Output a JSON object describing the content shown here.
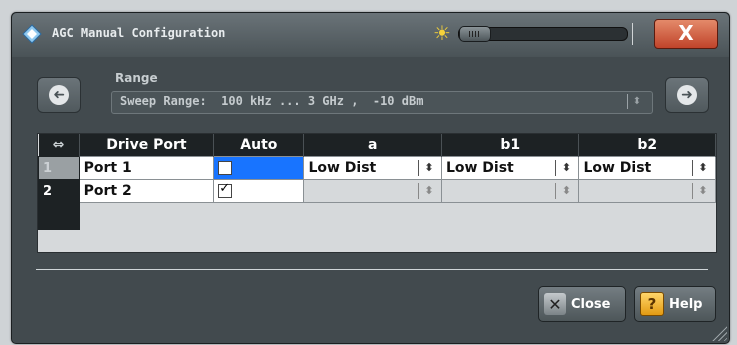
{
  "window": {
    "title": "AGC Manual Configuration",
    "close_symbol": "X"
  },
  "range": {
    "label": "Range",
    "value": "Sweep Range:  100 kHz ... 3 GHz ,  -10 dBm",
    "prev_icon": "arrow-left-icon",
    "next_icon": "arrow-right-icon"
  },
  "table": {
    "columns": [
      "Drive Port",
      "Auto",
      "a",
      "b1",
      "b2"
    ],
    "rows": [
      {
        "num": "1",
        "port": "Port 1",
        "auto": false,
        "a": "Low Dist",
        "b1": "Low Dist",
        "b2": "Low Dist"
      },
      {
        "num": "2",
        "port": "Port 2",
        "auto": true,
        "a": "",
        "b1": "",
        "b2": ""
      }
    ]
  },
  "footer": {
    "close_label": "Close",
    "help_label": "Help"
  },
  "colors": {
    "focus_cell": "#1874ff",
    "close_red": "#c0432a"
  }
}
